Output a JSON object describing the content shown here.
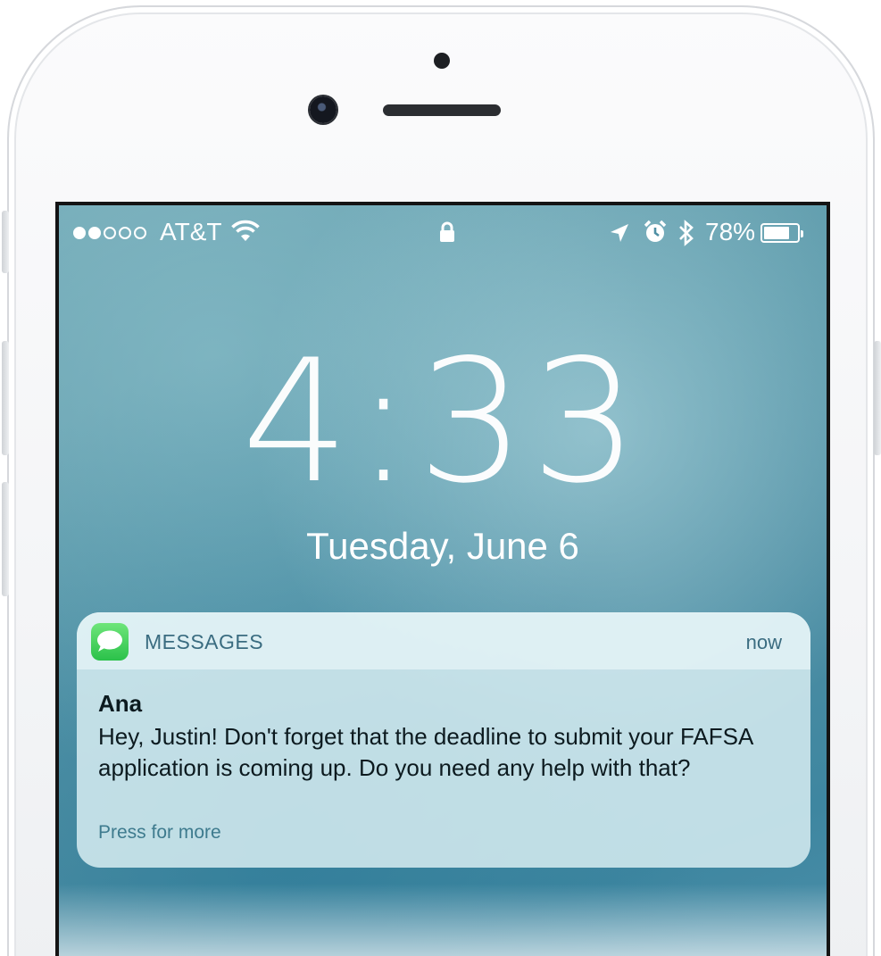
{
  "status_bar": {
    "signal_bars_filled": 2,
    "signal_bars_total": 5,
    "carrier": "AT&T",
    "wifi_icon": "wifi-icon",
    "lock_icon": "lock-icon",
    "location_icon": "location-arrow-icon",
    "alarm_icon": "alarm-clock-icon",
    "bluetooth_icon": "bluetooth-icon",
    "battery_percent": "78%",
    "battery_level": 0.78
  },
  "lock_screen": {
    "time": "4:33",
    "date": "Tuesday, June 6"
  },
  "notification": {
    "app_icon": "messages-icon",
    "app_name": "MESSAGES",
    "timestamp": "now",
    "sender": "Ana",
    "body": "Hey, Justin! Don't forget that the deadline to submit your FAFSA application is coming up. Do you need any help with that?",
    "action_hint": "Press for more"
  },
  "colors": {
    "wallpaper": "#5c9aab",
    "notification_accent": "#3a6c80",
    "messages_green": "#2bc14a"
  }
}
